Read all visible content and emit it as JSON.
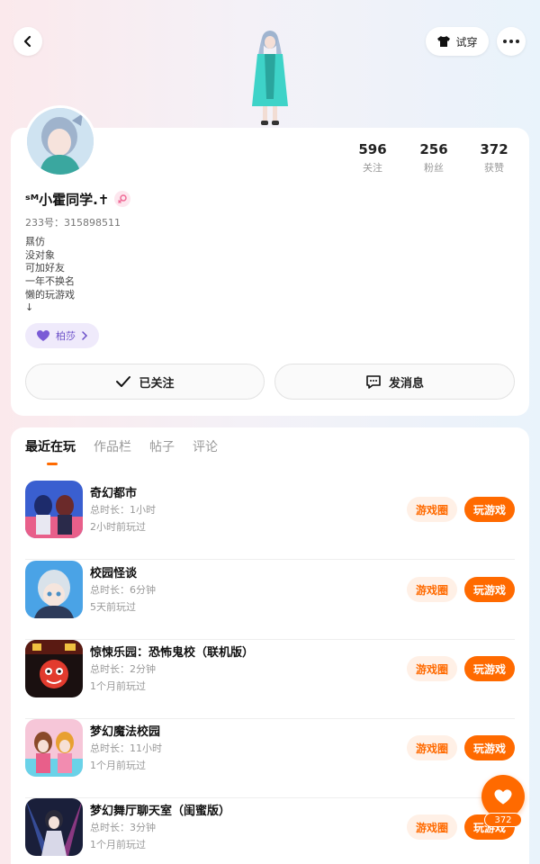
{
  "header": {
    "try_on_label": "试穿",
    "back_icon": "back-arrow-icon",
    "more_icon": "more-dots-icon"
  },
  "profile": {
    "nickname": "ˢᴹ小霍同学.✝",
    "uid": "233号：315898511",
    "bio": [
      "㬎仿",
      "没对象",
      "可加好友",
      "一年不换名",
      "懒的玩游戏",
      "↓"
    ],
    "tag_label": "柏莎",
    "stats": [
      {
        "value": "596",
        "label": "关注"
      },
      {
        "value": "256",
        "label": "粉丝"
      },
      {
        "value": "372",
        "label": "获赞"
      }
    ],
    "follow_label": "已关注",
    "message_label": "发消息"
  },
  "tabs": [
    {
      "label": "最近在玩",
      "active": true
    },
    {
      "label": "作品栏",
      "active": false
    },
    {
      "label": "帖子",
      "active": false
    },
    {
      "label": "评论",
      "active": false
    }
  ],
  "games": [
    {
      "title": "奇幻都市",
      "duration": "总时长：1小时",
      "last_played": "2小时前玩过",
      "circle_label": "游戏圈",
      "play_label": "玩游戏"
    },
    {
      "title": "校园怪谈",
      "duration": "总时长：6分钟",
      "last_played": "5天前玩过",
      "circle_label": "游戏圈",
      "play_label": "玩游戏"
    },
    {
      "title": "惊悚乐园：恐怖鬼校（联机版）",
      "duration": "总时长：2分钟",
      "last_played": "1个月前玩过",
      "circle_label": "游戏圈",
      "play_label": "玩游戏"
    },
    {
      "title": "梦幻魔法校园",
      "duration": "总时长：11小时",
      "last_played": "1个月前玩过",
      "circle_label": "游戏圈",
      "play_label": "玩游戏"
    },
    {
      "title": "梦幻舞厅聊天室（闺蜜版）",
      "duration": "总时长：3分钟",
      "last_played": "1个月前玩过",
      "circle_label": "游戏圈",
      "play_label": "玩游戏"
    }
  ],
  "like_fab": {
    "count": "372"
  },
  "colors": {
    "accent": "#ff6a00",
    "tag": "#6a4fc8"
  }
}
